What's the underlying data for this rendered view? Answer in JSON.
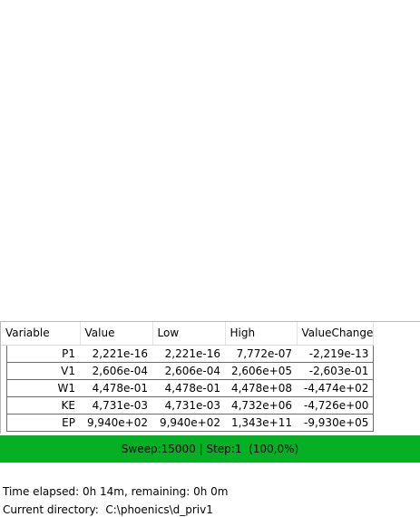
{
  "table": {
    "columns": [
      "Variable",
      "Value",
      "Low",
      "High",
      "ValueChange"
    ],
    "rows": [
      {
        "variable": "P1",
        "value": "2,221e-16",
        "low": "2,221e-16",
        "high": "7,772e-07",
        "change": "-2,219e-13"
      },
      {
        "variable": "V1",
        "value": "2,606e-04",
        "low": "2,606e-04",
        "high": "2,606e+05",
        "change": "-2,603e-01"
      },
      {
        "variable": "W1",
        "value": "4,478e-01",
        "low": "4,478e-01",
        "high": "4,478e+08",
        "change": "-4,474e+02"
      },
      {
        "variable": "KE",
        "value": "4,731e-03",
        "low": "4,731e-03",
        "high": "4,732e+06",
        "change": "-4,726e+00"
      },
      {
        "variable": "EP",
        "value": "9,940e+02",
        "low": "9,940e+02",
        "high": "1,343e+11",
        "change": "-9,930e+05"
      }
    ]
  },
  "status": {
    "text": "Sweep:15000 | Step:1  (100,0%)",
    "progress": 1.0,
    "color": "#06b025"
  },
  "info": {
    "time": "Time elapsed: 0h 14m, remaining: 0h 0m",
    "directory": "Current directory:  C:\\phoenics\\d_priv1"
  }
}
